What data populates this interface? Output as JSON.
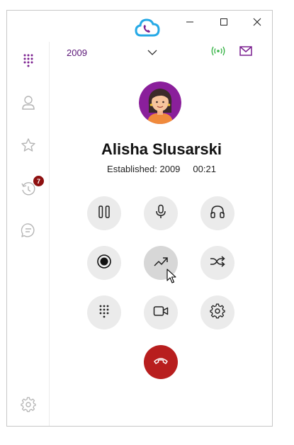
{
  "window": {
    "controls": {
      "minimize": "minimize-icon",
      "maximize": "maximize-icon",
      "close": "close-icon"
    },
    "logo": "cloud-phone-logo"
  },
  "sidebar": {
    "items": [
      {
        "name": "dialpad",
        "icon": "dialpad-icon",
        "active": true
      },
      {
        "name": "contacts",
        "icon": "person-icon"
      },
      {
        "name": "favorites",
        "icon": "star-icon"
      },
      {
        "name": "history",
        "icon": "history-icon",
        "badge": "7"
      },
      {
        "name": "chat",
        "icon": "chat-icon"
      }
    ],
    "settings_icon": "gear-icon"
  },
  "header": {
    "line_number": "2009",
    "line_dropdown_icon": "chevron-down-icon",
    "connection_icon": "signal-icon",
    "mail_icon": "mail-icon"
  },
  "call": {
    "contact_name": "Alisha Slusarski",
    "status": "Established: 2009",
    "timer": "00:21"
  },
  "controls": {
    "row1": [
      "hold-icon",
      "microphone-icon",
      "headset-icon"
    ],
    "row2": [
      "record-icon",
      "transfer-icon",
      "forward-icon"
    ],
    "row3": [
      "dialpad-icon",
      "video-icon",
      "gear-icon"
    ],
    "hangup": "hangup-icon"
  },
  "colors": {
    "accent": "#7a1f8f",
    "hangup": "#b81e1e",
    "connected": "#3bb54a",
    "badge": "#8e1010",
    "button_bg": "#ebebeb"
  }
}
